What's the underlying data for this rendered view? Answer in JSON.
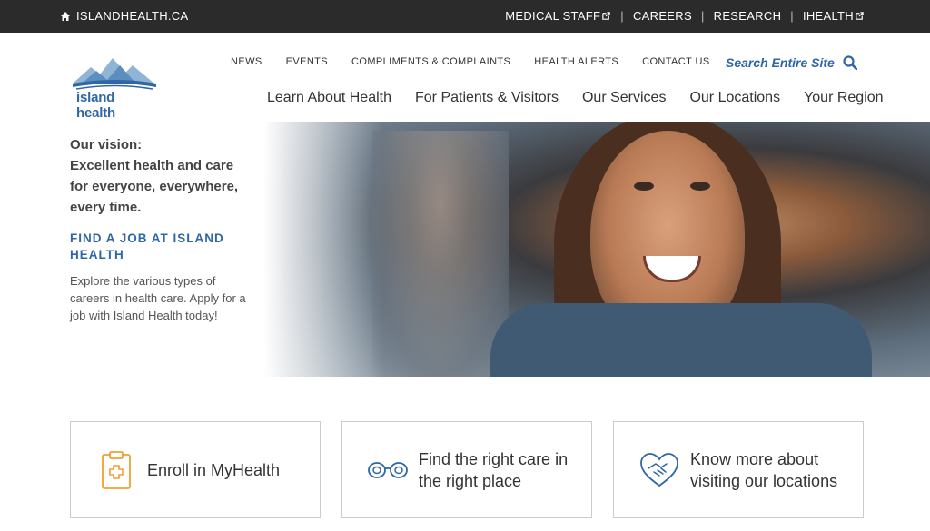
{
  "topbar": {
    "home_label": "ISLANDHEALTH.CA",
    "links": [
      "MEDICAL STAFF",
      "CAREERS",
      "RESEARCH",
      "IHEALTH"
    ],
    "separator": "|"
  },
  "logo": {
    "brand": "island health"
  },
  "utility_nav": [
    "NEWS",
    "EVENTS",
    "COMPLIMENTS & COMPLAINTS",
    "HEALTH ALERTS",
    "CONTACT US"
  ],
  "search": {
    "label": "Search Entire Site"
  },
  "main_nav": [
    "Learn About Health",
    "For Patients & Visitors",
    "Our Services",
    "Our Locations",
    "Your Region"
  ],
  "hero": {
    "vision": [
      "Our vision:",
      "Excellent health and care",
      "for everyone, everywhere,",
      "every time."
    ],
    "job_heading": "FIND A JOB AT ISLAND HEALTH",
    "job_text": "Explore the various types of careers in health care. Apply for a job with Island Health today!"
  },
  "cards": [
    {
      "label": "Enroll in MyHealth",
      "icon": "clipboard-medical-icon"
    },
    {
      "label": "Find the right care in the right place",
      "icon": "binoculars-icon"
    },
    {
      "label": "Know more about visiting our locations",
      "icon": "heart-handshake-icon"
    }
  ],
  "colors": {
    "topbar": "#2b2b2b",
    "brand_blue": "#2f67a6",
    "accent_orange": "#f0a030"
  }
}
